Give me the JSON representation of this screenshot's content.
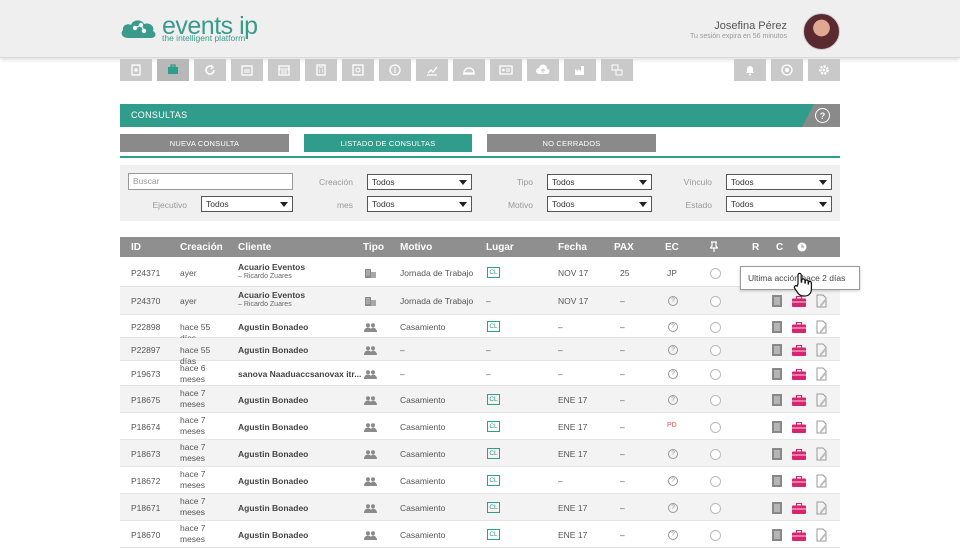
{
  "header": {
    "logo_text": "events ip",
    "logo_tagline": "the intelligent platform",
    "user_name": "Josefina Pérez",
    "session_text": "Tu sesión expira en 56 minutos"
  },
  "toolbar": {
    "icons": [
      "add-document-icon",
      "briefcase-icon",
      "refresh-icon",
      "calendar-week-icon",
      "calendar-month-icon",
      "calculator-icon",
      "safe-icon",
      "money-icon",
      "chart-icon",
      "dome-icon",
      "id-card-icon",
      "cloud-upload-icon",
      "factory-icon",
      "transfer-icon"
    ],
    "right_icons": [
      "bell-icon",
      "target-icon",
      "settings-icon"
    ],
    "active_index": 1
  },
  "section": {
    "title": "CONSULTAS",
    "help": "?"
  },
  "tabs": [
    {
      "label": "NUEVA CONSULTA",
      "active": false
    },
    {
      "label": "LISTADO DE CONSULTAS",
      "active": true
    },
    {
      "label": "NO CERRADOS",
      "active": false
    }
  ],
  "filters": {
    "search_placeholder": "Buscar",
    "creacion_label": "Creación",
    "creacion_value": "Todos",
    "tipo_label": "Tipo",
    "tipo_value": "Todos",
    "vinculo_label": "Vínculo",
    "vinculo_value": "Todos",
    "ejecutivo_label": "Ejecutivo",
    "ejecutivo_value": "Todos",
    "mes_label": "mes",
    "mes_value": "Todos",
    "motivo_label": "Motivo",
    "motivo_value": "Todos",
    "estado_label": "Estado",
    "estado_value": "Todos"
  },
  "table": {
    "columns": [
      "ID",
      "Creación",
      "Cliente",
      "Tipo",
      "Motivo",
      "Lugar",
      "Fecha",
      "PAX",
      "EC",
      "R",
      "C"
    ],
    "rows": [
      {
        "id": "P24371",
        "creacion": "ayer",
        "cliente": "Acuario Eventos",
        "contacto": "– Ricardo Zuares",
        "tipo": "building",
        "motivo": "Jornada de Trabajo",
        "lugar": "CL",
        "fecha": "NOV 17",
        "pax": "25",
        "ec": "JP",
        "actions": false
      },
      {
        "id": "P24370",
        "creacion": "ayer",
        "cliente": "Acuario Eventos",
        "contacto": "– Ricardo Zuares",
        "tipo": "building",
        "motivo": "Jornada de Trabajo",
        "lugar": "–",
        "fecha": "NOV 17",
        "pax": "–",
        "ec": "?",
        "actions": true
      },
      {
        "id": "P22898",
        "creacion": "hace 55 días",
        "cliente": "Agustin Bonadeo",
        "contacto": "",
        "tipo": "people",
        "motivo": "Casamiento",
        "lugar": "CL",
        "fecha": "–",
        "pax": "–",
        "ec": "?",
        "actions": true
      },
      {
        "id": "P22897",
        "creacion": "hace 55 días",
        "cliente": "Agustin Bonadeo",
        "contacto": "",
        "tipo": "people",
        "motivo": "–",
        "lugar": "–",
        "fecha": "–",
        "pax": "–",
        "ec": "?",
        "actions": true
      },
      {
        "id": "P19673",
        "creacion": "hace 6 meses",
        "cliente": "sanova Naaduaccsanovax itr...",
        "contacto": "",
        "tipo": "people",
        "motivo": "–",
        "lugar": "–",
        "fecha": "–",
        "pax": "–",
        "ec": "?",
        "actions": true
      },
      {
        "id": "P18675",
        "creacion": "hace 7 meses",
        "cliente": "Agustin Bonadeo",
        "contacto": "",
        "tipo": "people",
        "motivo": "Casamiento",
        "lugar": "CL",
        "fecha": "ENE 17",
        "pax": "–",
        "ec": "?",
        "actions": true
      },
      {
        "id": "P18674",
        "creacion": "hace 7 meses",
        "cliente": "Agustin Bonadeo",
        "contacto": "",
        "tipo": "people",
        "motivo": "Casamiento",
        "lugar": "CL",
        "fecha": "ENE 17",
        "pax": "–",
        "ec": "PD",
        "actions": true
      },
      {
        "id": "P18673",
        "creacion": "hace 7 meses",
        "cliente": "Agustin Bonadeo",
        "contacto": "",
        "tipo": "people",
        "motivo": "Casamiento",
        "lugar": "CL",
        "fecha": "ENE 17",
        "pax": "–",
        "ec": "?",
        "actions": true
      },
      {
        "id": "P18672",
        "creacion": "hace 7 meses",
        "cliente": "Agustin Bonadeo",
        "contacto": "",
        "tipo": "people",
        "motivo": "Casamiento",
        "lugar": "CL",
        "fecha": "–",
        "pax": "–",
        "ec": "?",
        "actions": true
      },
      {
        "id": "P18671",
        "creacion": "hace 7 meses",
        "cliente": "Agustin Bonadeo",
        "contacto": "",
        "tipo": "people",
        "motivo": "Casamiento",
        "lugar": "CL",
        "fecha": "ENE 17",
        "pax": "–",
        "ec": "?",
        "actions": true
      },
      {
        "id": "P18670",
        "creacion": "hace 7 meses",
        "cliente": "Agustin Bonadeo",
        "contacto": "",
        "tipo": "people",
        "motivo": "Casamiento",
        "lugar": "CL",
        "fecha": "ENE 17",
        "pax": "–",
        "ec": "?",
        "actions": true
      }
    ]
  },
  "tooltip": "Ultima acción hace 2 días",
  "colors": {
    "teal": "#2f9c8c",
    "gray_header": "#8f8f8f",
    "tab_inactive": "#8a8a8a",
    "ec_red": "#e0524f",
    "briefcase_pink": "#d6246e"
  }
}
